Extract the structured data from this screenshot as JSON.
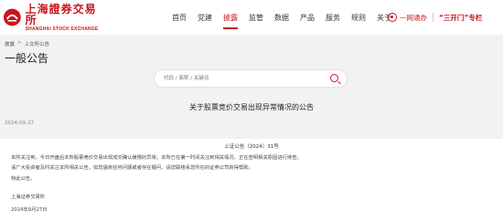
{
  "header": {
    "logo_cn": "上海證券交易所",
    "logo_en": "SHANGHAI STOCK EXCHANGE",
    "nav": [
      "首页",
      "党建",
      "披露",
      "监管",
      "数据",
      "产品",
      "服务",
      "规则",
      "关于"
    ],
    "active_nav_index": 2,
    "promo_left": "一网通办",
    "promo_right": "“三开门”专栏",
    "accent_color": "#c8151d"
  },
  "breadcrumb": {
    "items": [
      "披露",
      "上交所公告"
    ],
    "separator": ">"
  },
  "page_title": "一般公告",
  "search": {
    "placeholder": "代码 / 简称 / 关键词"
  },
  "article": {
    "title": "关于股票竞价交易出现异常情况的公告",
    "date": "2024-09-27",
    "doc_no": "上证公告〔2024〕31号",
    "paragraphs": [
      "本所关注到，今日开盘后本所股票竞价交易出现成交确认缓慢的异常。本所已在第一时间关注到相关情况，正在查明相关原因进行排查。",
      "请广大投资者及时关注本所相关公告。如您遇到任何问题或者存在疑问，请您联络系您所在的证券公司获得帮助。",
      "特此公告。"
    ],
    "signature_org": "上海证券交易所",
    "signature_date": "2024年9月27日"
  }
}
